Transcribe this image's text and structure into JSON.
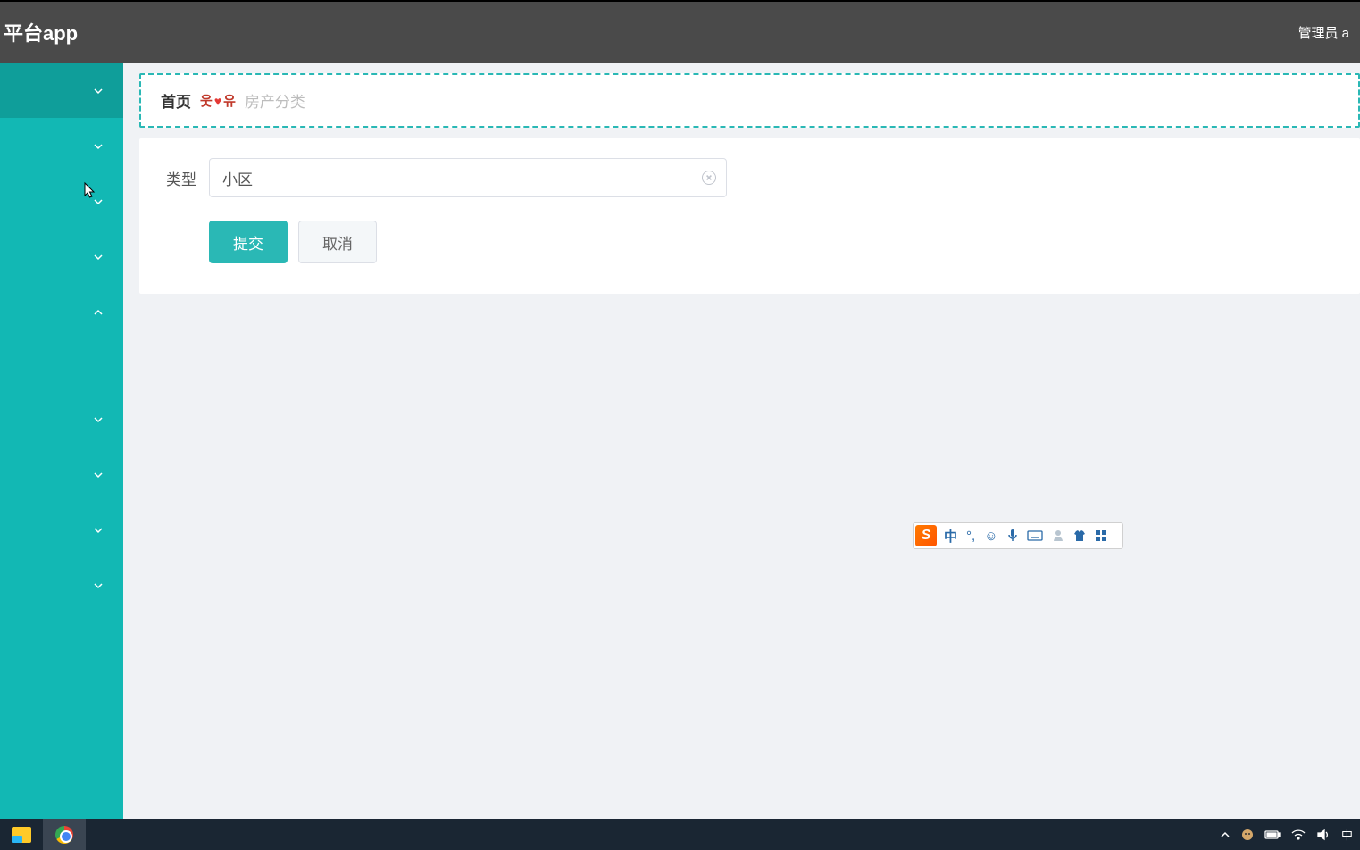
{
  "header": {
    "title": "平台app",
    "user": "管理员 a"
  },
  "sidebar": {
    "items": [
      {
        "expanded": false,
        "active": true
      },
      {
        "expanded": false,
        "active": false
      },
      {
        "expanded": false,
        "active": false
      },
      {
        "expanded": false,
        "active": false
      },
      {
        "expanded": true,
        "active": false
      },
      {
        "expanded": false,
        "active": false
      },
      {
        "expanded": false,
        "active": false
      },
      {
        "expanded": false,
        "active": false
      },
      {
        "expanded": false,
        "active": false
      }
    ]
  },
  "breadcrumb": {
    "home": "首页",
    "current": "房产分类"
  },
  "form": {
    "type_label": "类型",
    "type_value": "小区",
    "submit_label": "提交",
    "cancel_label": "取消"
  },
  "ime": {
    "logo": "S",
    "lang": "中"
  },
  "taskbar": {
    "lang": "中"
  }
}
